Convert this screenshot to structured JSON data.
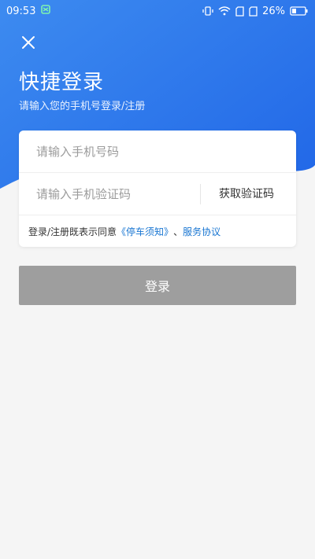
{
  "status_bar": {
    "time": "09:53",
    "battery": "26%"
  },
  "header": {
    "title": "快捷登录",
    "subtitle": "请输入您的手机号登录/注册"
  },
  "form": {
    "phone_placeholder": "请输入手机号码",
    "code_placeholder": "请输入手机验证码",
    "get_code_label": "获取验证码",
    "agree_prefix": "登录/注册既表示同意",
    "agree_link1": "《停车须知》",
    "agree_sep": "、",
    "agree_link2": "服务协议"
  },
  "login_button": {
    "label": "登录"
  },
  "colors": {
    "primary": "#2f7ef2",
    "link": "#1976d2",
    "disabled_button": "#9e9e9e"
  }
}
